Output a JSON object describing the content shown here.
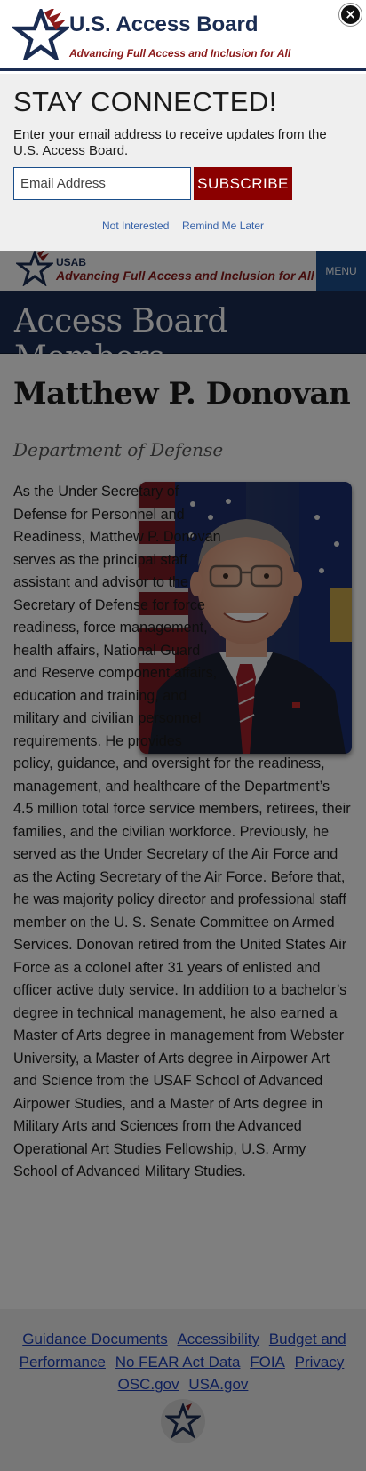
{
  "modal": {
    "title": "U.S. Access Board",
    "tagline": "Advancing Full Access and Inclusion for All",
    "close_label": "×",
    "heading": "STAY CONNECTED!",
    "description": "Enter your email address to receive updates from the U.S. Access Board.",
    "email_placeholder": "Email Address",
    "subscribe_label": "SUBSCRIBE",
    "not_interested_label": "Not Interested",
    "remind_later_label": "Remind Me Later"
  },
  "header": {
    "abbr": "USAB",
    "tagline": "Advancing Full Access and Inclusion for All",
    "menu_label": "MENU"
  },
  "banner": {
    "title": "Access Board Members"
  },
  "member": {
    "name": "Matthew P. Donovan",
    "agency": "Department of Defense",
    "bio": "As the Under Secretary of Defense for Personnel and Readiness, Matthew P. Donovan serves as the principal staff assistant and advisor to the Secretary of Defense for force readiness, force management, health affairs, National Guard and Reserve component affairs, education and training, and military and civilian personnel requirements. He provides policy, guidance, and oversight for the readiness, management, and healthcare of the Department’s 4.5 million total force service members, retirees, their families, and the civilian workforce. Previously, he served as the Under Secretary of the Air Force and as the Acting Secretary of the Air Force. Before that, he was majority policy director and professional staff member on the U. S. Senate Committee on Armed Services. Donovan retired from the United States Air Force as a colonel after 31 years of enlisted and officer active duty service. In addition to a bachelor’s degree in technical management, he also earned a Master of Arts degree in management from Webster University, a Master of Arts degree in Airpower Art and Science from the USAF School of Advanced Airpower Studies, and a Master of Arts degree in Military Arts and Sciences from the Advanced Operational Art Studies Fellowship, U.S. Army School of Advanced Military Studies."
  },
  "footer": {
    "links": [
      "Guidance Documents",
      "Accessibility",
      "Budget and Performance",
      "No FEAR Act Data",
      "FOIA",
      "Privacy",
      "OSC.gov",
      "USA.gov"
    ]
  },
  "colors": {
    "navy": "#1a2c52",
    "brand_red": "#8b1a1a",
    "menu_blue": "#1d4f8c",
    "subscribe_red": "#8b0000",
    "link_blue": "#1d3fb5"
  },
  "icons": {
    "logo": "star-logo-icon",
    "close": "close-icon",
    "seal": "star-seal-icon"
  }
}
